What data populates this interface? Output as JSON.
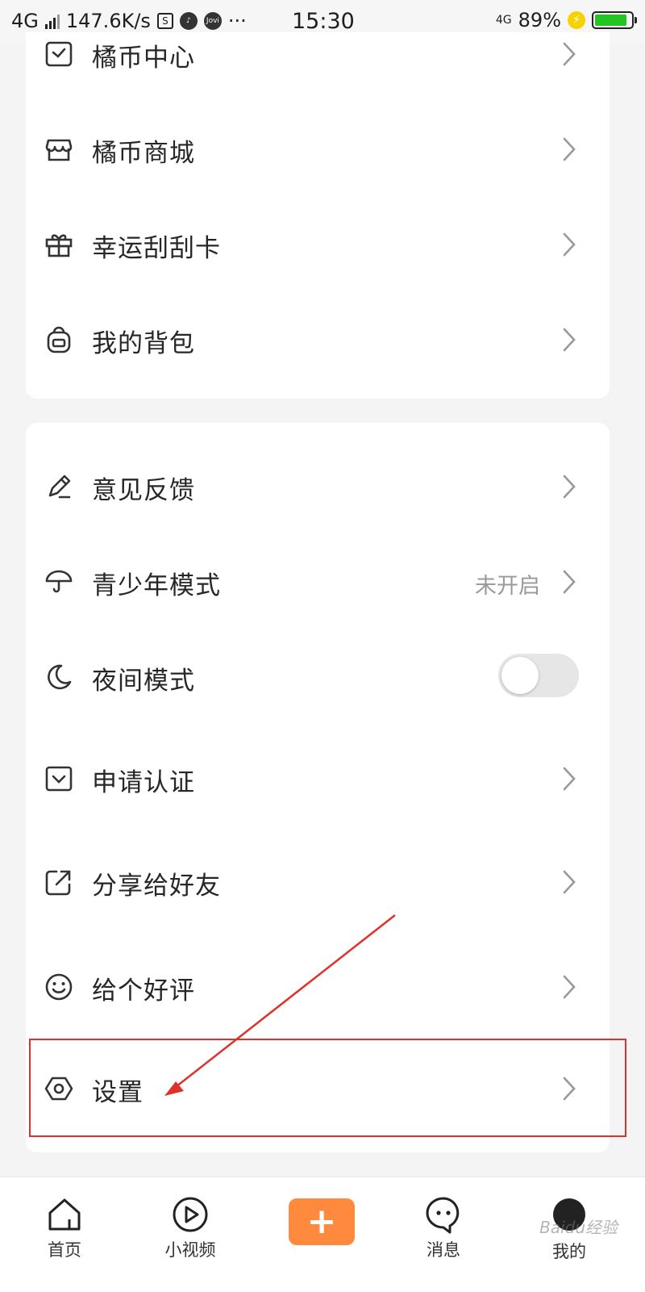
{
  "status_bar": {
    "network": "4G",
    "speed": "147.6K/s",
    "time": "15:30",
    "network_right": "4G",
    "battery": "89%",
    "battery_level": 0.89,
    "app_icon_text": "Jovi",
    "more_text": "···"
  },
  "menu_group_1": [
    {
      "label": "橘币中心",
      "icon": "coin-center-icon"
    },
    {
      "label": "橘币商城",
      "icon": "store-icon"
    },
    {
      "label": "幸运刮刮卡",
      "icon": "gift-icon"
    },
    {
      "label": "我的背包",
      "icon": "backpack-icon"
    }
  ],
  "menu_group_2": [
    {
      "label": "意见反馈",
      "icon": "pencil-icon"
    },
    {
      "label": "青少年模式",
      "icon": "umbrella-icon",
      "value": "未开启"
    },
    {
      "label": "夜间模式",
      "icon": "moon-icon",
      "toggle": false
    },
    {
      "label": "申请认证",
      "icon": "certificate-icon"
    },
    {
      "label": "分享给好友",
      "icon": "share-icon"
    },
    {
      "label": "给个好评",
      "icon": "smile-icon"
    },
    {
      "label": "设置",
      "icon": "settings-icon"
    }
  ],
  "bottom_nav": [
    {
      "label": "首页",
      "icon": "home-icon"
    },
    {
      "label": "小视频",
      "icon": "video-play-icon"
    },
    {
      "label": "",
      "icon": "plus-icon"
    },
    {
      "label": "消息",
      "icon": "message-icon"
    },
    {
      "label": "我的",
      "icon": "avatar"
    }
  ],
  "plus_symbol": "+",
  "watermark": "Baidu经验",
  "colors": {
    "accent_orange": "#ff8a3d",
    "highlight_red": "#e0302c",
    "battery_green": "#22c522",
    "muted_text": "#9a9a9a"
  }
}
